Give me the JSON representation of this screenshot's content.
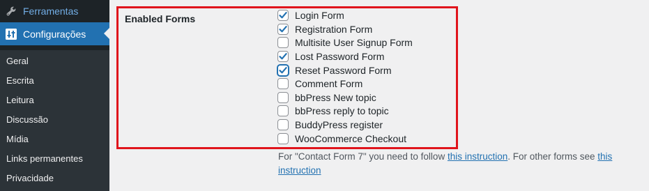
{
  "sidebar": {
    "tools_label": "Ferramentas",
    "settings_label": "Configurações",
    "submenu": [
      "Geral",
      "Escrita",
      "Leitura",
      "Discussão",
      "Mídia",
      "Links permanentes",
      "Privacidade"
    ]
  },
  "form": {
    "label": "Enabled Forms",
    "options": [
      {
        "label": "Login Form",
        "checked": true
      },
      {
        "label": "Registration Form",
        "checked": true
      },
      {
        "label": "Multisite User Signup Form",
        "checked": false
      },
      {
        "label": "Lost Password Form",
        "checked": true
      },
      {
        "label": "Reset Password Form",
        "checked": true,
        "focused": true
      },
      {
        "label": "Comment Form",
        "checked": false
      },
      {
        "label": "bbPress New topic",
        "checked": false
      },
      {
        "label": "bbPress reply to topic",
        "checked": false
      },
      {
        "label": "BuddyPress register",
        "checked": false
      },
      {
        "label": "WooCommerce Checkout",
        "checked": false
      }
    ]
  },
  "description": {
    "part1": "For \"Contact Form 7\" you need to follow ",
    "link1": "this instruction",
    "part2": ". For other forms see ",
    "link2a": "this",
    "link2b": "instruction"
  },
  "colors": {
    "highlight_frame": "#e0141c",
    "accent": "#2271b1",
    "link": "#2271b1"
  },
  "icons": {
    "tools": "wrench-icon",
    "settings": "settings-icon"
  }
}
